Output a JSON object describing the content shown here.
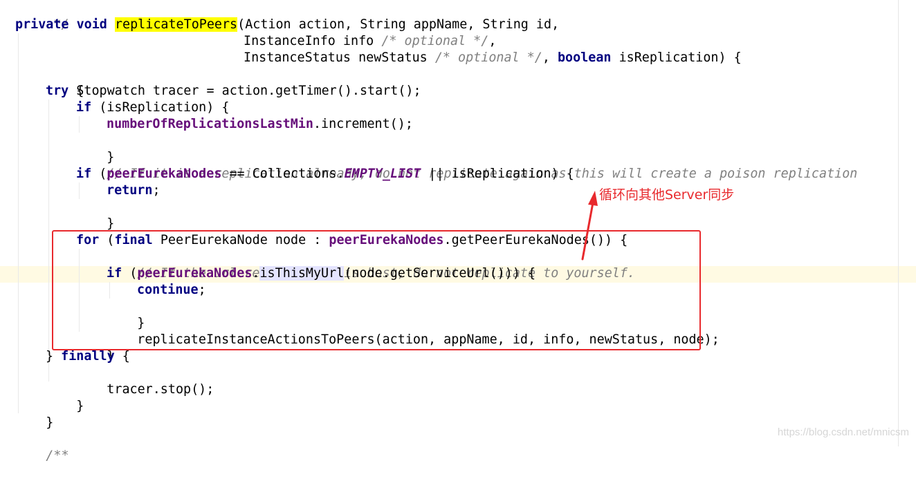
{
  "code": {
    "comment_close": " */",
    "l1": {
      "kw_private": "private",
      "kw_void": "void",
      "method": "replicateToPeers",
      "rest": "(Action action, String appName, String id,"
    },
    "l2": {
      "text": "InstanceInfo info ",
      "comment": "/* optional */",
      "tail": ","
    },
    "l3": {
      "text": "InstanceStatus newStatus ",
      "comment": "/* optional */",
      "sep": ", ",
      "kw_boolean": "boolean",
      "tail": " isReplication) {"
    },
    "l4": "Stopwatch tracer = action.getTimer().start();",
    "l5": {
      "kw_try": "try",
      "tail": " {"
    },
    "l6": {
      "kw_if": "if",
      "tail": " (isReplication) {"
    },
    "l7": {
      "field": "numberOfReplicationsLastMin",
      "tail": ".increment();"
    },
    "l8": "}",
    "l9": "// If it is a replication already, do not replicate again as this will create a poison replication",
    "l10": {
      "kw_if": "if",
      "open": " (",
      "field": "peerEurekaNodes",
      "mid": " == Collections.",
      "static": "EMPTY_LIST",
      "tail": " || isReplication) {"
    },
    "l11": {
      "kw_return": "return",
      "tail": ";"
    },
    "l12": "}",
    "l13": {
      "kw_for": "for",
      "open": " (",
      "kw_final": "final",
      "mid": " PeerEurekaNode node : ",
      "field": "peerEurekaNodes",
      "tail": ".getPeerEurekaNodes()) {"
    },
    "l14": "// If the url represents this host, do not replicate to yourself.",
    "l15": {
      "kw_if": "if",
      "open": " (",
      "field": "peerEurekaNodes",
      "dot": ".",
      "call": "isThisMyUrl",
      "tail": "(node.getServiceUrl())) {"
    },
    "l16": {
      "kw_continue": "continue",
      "tail": ";"
    },
    "l17": "}",
    "l18": "replicateInstanceActionsToPeers(action, appName, id, info, newStatus, node);",
    "l19": "}",
    "l20": {
      "head": "} ",
      "kw_finally": "finally",
      "tail": " {"
    },
    "l21": "tracer.stop();",
    "l22": "}",
    "l23": "}",
    "l24": "/**"
  },
  "annotation": {
    "label": "循环向其他Server同步",
    "color": "#e8292d"
  },
  "watermark": "https://blog.csdn.net/mnicsm",
  "colors": {
    "keyword": "#000080",
    "field": "#660e7a",
    "comment": "#808080",
    "method_highlight": "#ffff00",
    "caret_row": "#fffae3"
  }
}
